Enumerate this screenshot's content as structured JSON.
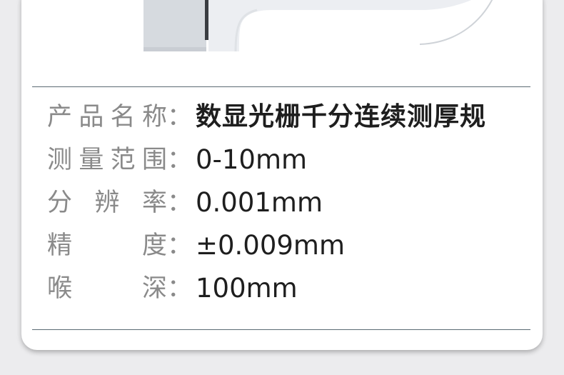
{
  "specs": [
    {
      "label": "产品名称",
      "colon": "：",
      "value": "数显光栅千分连续测厚规"
    },
    {
      "label": "测量范围",
      "colon": "：",
      "value": "0-10mm"
    },
    {
      "label": "分辨率",
      "colon": "：",
      "value": "0.001mm"
    },
    {
      "label": "精度",
      "colon": "：",
      "value": "±0.009mm"
    },
    {
      "label": "喉深",
      "colon": "：",
      "value": "100mm"
    }
  ]
}
